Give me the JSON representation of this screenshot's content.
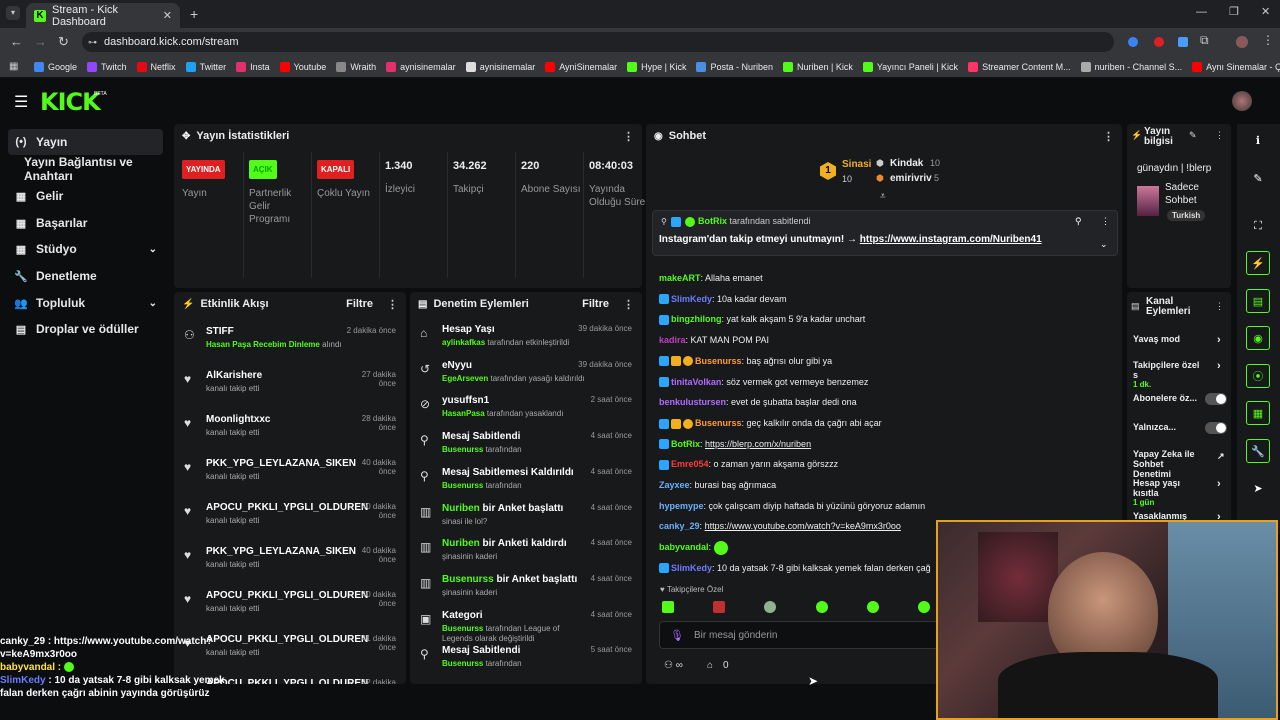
{
  "browser": {
    "tab_title": "Stream - Kick Dashboard",
    "url": "dashboard.kick.com/stream",
    "bookmarks": [
      {
        "label": "Google",
        "color": "#4285f4"
      },
      {
        "label": "Twitch",
        "color": "#9146ff"
      },
      {
        "label": "Netflix",
        "color": "#e50914"
      },
      {
        "label": "Twitter",
        "color": "#1da1f2"
      },
      {
        "label": "Insta",
        "color": "#e1306c"
      },
      {
        "label": "Youtube",
        "color": "#ff0000"
      },
      {
        "label": "Wraith",
        "color": "#888888"
      },
      {
        "label": "aynisinemalar",
        "color": "#e1306c"
      },
      {
        "label": "aynisinemalar",
        "color": "#dddddd"
      },
      {
        "label": "AyniSinemalar",
        "color": "#ff0000"
      },
      {
        "label": "Hype | Kick",
        "color": "#53fc18"
      },
      {
        "label": "Posta - Nuriben",
        "color": "#4a90e2"
      },
      {
        "label": "Nuriben | Kick",
        "color": "#53fc18"
      },
      {
        "label": "Yayıncı Paneli | Kick",
        "color": "#53fc18"
      },
      {
        "label": "Streamer Content M...",
        "color": "#ff3366"
      },
      {
        "label": "nuriben - Channel S...",
        "color": "#aaaaaa"
      },
      {
        "label": "Aynı Sinemalar - Ça...",
        "color": "#ff0000"
      }
    ]
  },
  "brand": {
    "logo": "KICK",
    "beta": "BETA"
  },
  "sidebar": [
    {
      "label": "Yayın",
      "icon": "(•)"
    },
    {
      "label": "Yayın Bağlantısı ve Anahtarı",
      "icon": ""
    },
    {
      "label": "Gelir",
      "icon": "▦"
    },
    {
      "label": "Başarılar",
      "icon": "▦"
    },
    {
      "label": "Stüdyo",
      "icon": "▦"
    },
    {
      "label": "Denetleme",
      "icon": "🔧"
    },
    {
      "label": "Topluluk",
      "icon": "👥"
    },
    {
      "label": "Droplar ve ödüller",
      "icon": "▤"
    }
  ],
  "stats": {
    "title": "Yayın İstatistikleri",
    "items": [
      {
        "badge": "YAYINDA",
        "badge_color": "#e02020",
        "label": "Yayın"
      },
      {
        "badge": "AÇIK",
        "badge_color": "#53fc18",
        "label": "Partnerlik Gelir Programı"
      },
      {
        "badge": "KAPALI",
        "badge_color": "#e02020",
        "label": "Çoklu Yayın"
      },
      {
        "value": "1.340",
        "label": "İzleyici"
      },
      {
        "value": "34.262",
        "label": "Takipçi"
      },
      {
        "value": "220",
        "label": "Abone Sayısı"
      },
      {
        "value": "08:40:03",
        "label": "Yayında Olduğu Süre"
      }
    ]
  },
  "activity": {
    "title": "Etkinlik Akışı",
    "filter": "Filtre",
    "rows": [
      {
        "name": "STIFF",
        "sub_green": "Hasan Paşa Recebim Dinleme",
        "sub": " alındı",
        "time": "2 dakika önce",
        "icon": "⚇"
      },
      {
        "name": "AlKarishere",
        "sub": "kanalı takip etti",
        "time": "27 dakika önce",
        "icon": "♥"
      },
      {
        "name": "Moonlightxxc",
        "sub": "kanalı takip etti",
        "time": "28 dakika önce",
        "icon": "♥"
      },
      {
        "name": "PKK_YPG_LEYLAZANA_SIKEN",
        "sub": "kanalı takip etti",
        "time": "40 dakika önce",
        "icon": "♥"
      },
      {
        "name": "APOCU_PKKLI_YPGLI_OLDUREN",
        "sub": "kanalı takip etti",
        "time": "40 dakika önce",
        "icon": "♥"
      },
      {
        "name": "PKK_YPG_LEYLAZANA_SIKEN",
        "sub": "kanalı takip etti",
        "time": "40 dakika önce",
        "icon": "♥"
      },
      {
        "name": "APOCU_PKKLI_YPGLI_OLDUREN",
        "sub": "kanalı takip etti",
        "time": "40 dakika önce",
        "icon": "♥"
      },
      {
        "name": "APOCU_PKKLI_YPGLI_OLDUREN",
        "sub": "kanalı takip etti",
        "time": "41 dakika önce",
        "icon": "♥"
      },
      {
        "name": "APOCU_PKKLI_YPGLI_OLDUREN",
        "sub": "kanalı takip etti",
        "time": "42 dakika önce",
        "icon": "♥"
      }
    ]
  },
  "moderation": {
    "title": "Denetim Eylemleri",
    "filter": "Filtre",
    "rows": [
      {
        "title": "Hesap Yaşı",
        "sub_green": "aylinkafkas",
        "sub": " tarafından etkinleştirildi",
        "time": "39 dakika önce",
        "icon": "⌂"
      },
      {
        "title": "eNyyu",
        "sub_green": "EgeArseven",
        "sub": " tarafından yasağı kaldırıldı",
        "time": "39 dakika önce",
        "icon": "↺"
      },
      {
        "title": "yusuffsn1",
        "sub_green": "HasanPasa",
        "sub": " tarafından yasaklandı",
        "time": "2 saat önce",
        "icon": "⊘"
      },
      {
        "title": "Mesaj Sabitlendi",
        "sub_green": "Busenurss",
        "sub": " tarafından",
        "time": "4 saat önce",
        "icon": "⚲"
      },
      {
        "title": "Mesaj Sabitlemesi Kaldırıldı",
        "sub_green": "Busenurss",
        "sub": " tarafından",
        "time": "4 saat önce",
        "icon": "⚲"
      },
      {
        "title_green": "Nuriben",
        "title": " bir Anket başlattı",
        "sub": "sinasi ile lol?",
        "time": "4 saat önce",
        "icon": "▥"
      },
      {
        "title_green": "Nuriben",
        "title": " bir Anketi kaldırdı",
        "sub": "şinasinin kaderi",
        "time": "4 saat önce",
        "icon": "▥"
      },
      {
        "title_green": "Busenurss",
        "title": " bir Anket başlattı",
        "sub": "şinasinin kaderi",
        "time": "4 saat önce",
        "icon": "▥"
      },
      {
        "title": "Kategori",
        "sub_green": "Busenurss",
        "sub": " tarafından League of Legends olarak değiştirildi",
        "time": "4 saat önce",
        "icon": "▣"
      },
      {
        "title": "Mesaj Sabitlendi",
        "sub_green": "Busenurss",
        "sub": " tarafından",
        "time": "5 saat önce",
        "icon": "⚲"
      }
    ]
  },
  "chat": {
    "title": "Sohbet",
    "leaderboard": [
      {
        "name": "Sinasi",
        "count": "10",
        "rank": "1"
      },
      {
        "name": "Kindak",
        "count": "10"
      },
      {
        "name": "emirivriv",
        "count": "5"
      }
    ],
    "pinned": {
      "by": "BotRix",
      "by_suffix": " tarafından sabitlendi",
      "text": "Instagram'dan takip etmeyi unutmayın! → ",
      "link": "https://www.instagram.com/Nuriben41"
    },
    "messages": [
      {
        "user": "makeART",
        "color": "#53fc18",
        "text": "Allaha emanet"
      },
      {
        "user": "SlimKedy",
        "color": "#6a7cff",
        "text": "10a kadar devam"
      },
      {
        "user": "bingzhilong",
        "color": "#53fc18",
        "text": "yat kalk akşam 5 9'a kadar unchart"
      },
      {
        "user": "kadira",
        "color": "#c040c0",
        "text": "KAT MAN POM PAI"
      },
      {
        "user": "Busenurss",
        "color": "#ff9a3c",
        "text": "baş ağrısı olur gibi ya"
      },
      {
        "user": "tinitaVolkan",
        "color": "#b06cff",
        "text": "söz vermek got vermeye benzemez"
      },
      {
        "user": "benkulustursen",
        "color": "#b06cff",
        "text": "evet de şubatta başlar dedi ona"
      },
      {
        "user": "Busenurss",
        "color": "#ff9a3c",
        "text": "geç kalkılır onda da çağrı abi açar"
      },
      {
        "user": "BotRix",
        "color": "#53fc18",
        "text": "https://blerp.com/x/nuriben",
        "link": true
      },
      {
        "user": "Emre054",
        "color": "#ff3b3b",
        "text": "o zaman yarın akşama görszzz"
      },
      {
        "user": "Zayxee",
        "color": "#6ab0ff",
        "text": "burasi baş ağrımaca"
      },
      {
        "user": "hypemype",
        "color": "#6ab0ff",
        "text": "çok çalışcam diyip haftada bi yüzünü göryoruz adamın"
      },
      {
        "user": "canky_29",
        "color": "#6ab0ff",
        "text": "https://www.youtube.com/watch?v=keA9mx3r0oo",
        "link": true
      },
      {
        "user": "babyvandal",
        "color": "#53fc18",
        "text": ""
      },
      {
        "user": "SlimKedy",
        "color": "#6a7cff",
        "text": "10 da yatsak 7-8 gibi kalksak yemek falan derken çağ"
      }
    ],
    "followers_only": "Takipçilere Özel",
    "input_placeholder": "Bir mesaj gönderin",
    "count": "0"
  },
  "stream_info": {
    "title": "Yayın bilgisi",
    "stream_title": "günaydın | !blerp",
    "category": "Sadece Sohbet",
    "language": "Turkish"
  },
  "channel_actions": {
    "title": "Kanal Eylemleri",
    "items": [
      {
        "label": "Yavaş mod",
        "type": "arrow"
      },
      {
        "label": "Takipçilere özel s",
        "sub": "1 dk.",
        "type": "arrow"
      },
      {
        "label": "Abonelere öz...",
        "type": "toggle"
      },
      {
        "label": "Yalnızca...",
        "type": "toggle"
      },
      {
        "label": "Yapay Zeka ile Sohbet Denetimi",
        "type": "ext"
      },
      {
        "label": "Hesap yaşı kısıtla",
        "sub": "1 gün",
        "type": "arrow"
      },
      {
        "label": "Yasaklanmış kelim",
        "type": "arrow"
      }
    ]
  },
  "overlay_chat": [
    {
      "user": "canky_29",
      "color": "#ffffff",
      "text": " : https://www.youtube.com/watch?v=keA9mx3r0oo"
    },
    {
      "user": "babyvandal",
      "color": "#ffe14a",
      "text": " :"
    },
    {
      "user": "SlimKedy",
      "color": "#6a7cff",
      "text": " : 10 da yatsak 7-8 gibi kalksak yemek falan derken çağrı abinin yayında görüşürüz"
    }
  ]
}
